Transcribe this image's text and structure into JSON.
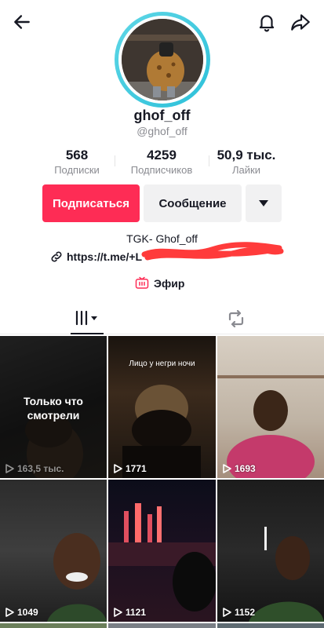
{
  "profile": {
    "username": "ghof_off",
    "handle": "@ghof_off",
    "bio": "TGK- Ghof_off",
    "link": "https://t.me/+L",
    "live_label": "Эфир"
  },
  "stats": {
    "following": {
      "value": "568",
      "label": "Подписки"
    },
    "followers": {
      "value": "4259",
      "label": "Подписчиков"
    },
    "likes": {
      "value": "50,9 тыс.",
      "label": "Лайки"
    }
  },
  "actions": {
    "follow_label": "Подписаться",
    "message_label": "Сообщение"
  },
  "colors": {
    "accent": "#fe2c55",
    "avatar_ring": "#2cc0d9",
    "redaction": "#ff3b3b"
  },
  "icons": [
    "back-arrow-icon",
    "bell-icon",
    "share-arrow-icon",
    "link-icon",
    "tv-icon",
    "videos-grid-icon",
    "repost-icon",
    "play-icon",
    "chevron-down-icon"
  ],
  "videos": [
    {
      "views": "163,5 тыс.",
      "overlay": "Только что смотрели"
    },
    {
      "views": "1771",
      "caption": "Лицо у негри ночи"
    },
    {
      "views": "1693"
    },
    {
      "views": "1049"
    },
    {
      "views": "1121"
    },
    {
      "views": "1152"
    }
  ]
}
